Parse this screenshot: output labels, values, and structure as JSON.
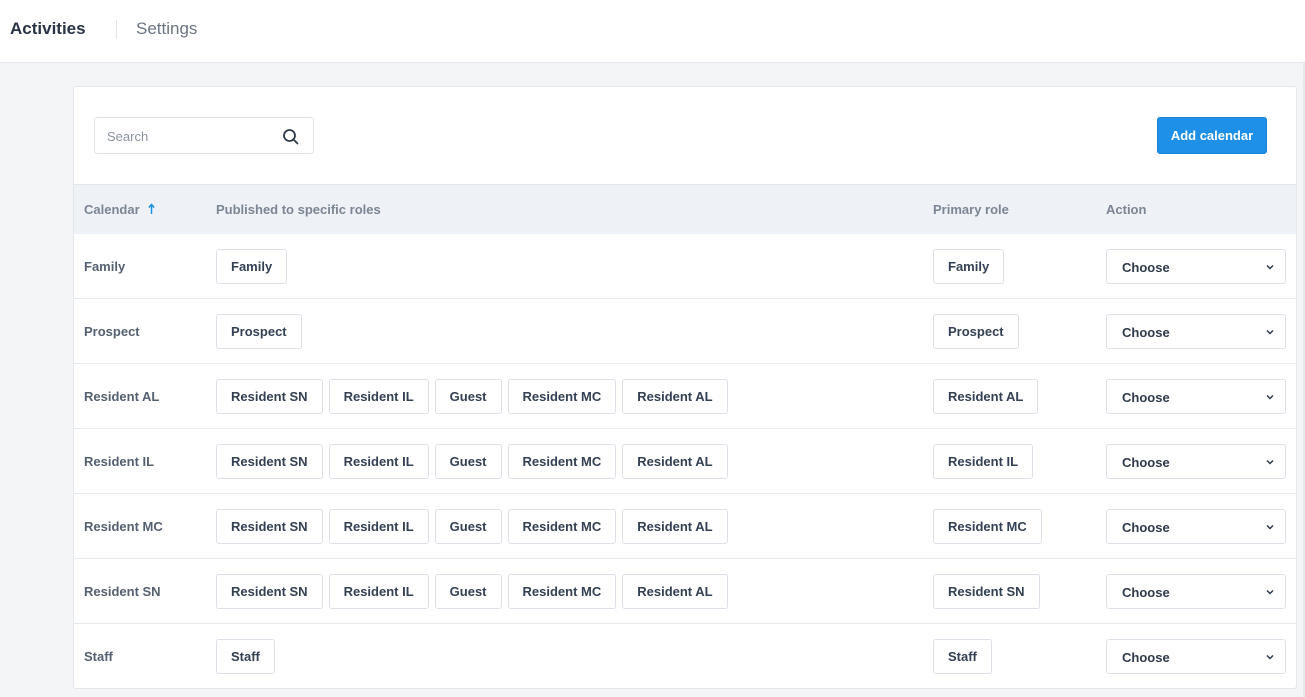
{
  "nav": {
    "active_tab": "Activities",
    "inactive_tab": "Settings"
  },
  "toolbar": {
    "search_placeholder": "Search",
    "search_icon": "search-icon",
    "add_button_label": "Add calendar"
  },
  "table": {
    "columns": {
      "calendar": "Calendar",
      "roles": "Published to specific roles",
      "primary": "Primary role",
      "action": "Action"
    },
    "sort_icon": "arrow-up-icon",
    "rows": [
      {
        "name": "Family",
        "roles": [
          "Family"
        ],
        "primary": "Family",
        "action": "Choose"
      },
      {
        "name": "Prospect",
        "roles": [
          "Prospect"
        ],
        "primary": "Prospect",
        "action": "Choose"
      },
      {
        "name": "Resident AL",
        "roles": [
          "Resident SN",
          "Resident IL",
          "Guest",
          "Resident MC",
          "Resident AL"
        ],
        "primary": "Resident AL",
        "action": "Choose"
      },
      {
        "name": "Resident IL",
        "roles": [
          "Resident SN",
          "Resident IL",
          "Guest",
          "Resident MC",
          "Resident AL"
        ],
        "primary": "Resident IL",
        "action": "Choose"
      },
      {
        "name": "Resident MC",
        "roles": [
          "Resident SN",
          "Resident IL",
          "Guest",
          "Resident MC",
          "Resident AL"
        ],
        "primary": "Resident MC",
        "action": "Choose"
      },
      {
        "name": "Resident SN",
        "roles": [
          "Resident SN",
          "Resident IL",
          "Guest",
          "Resident MC",
          "Resident AL"
        ],
        "primary": "Resident SN",
        "action": "Choose"
      },
      {
        "name": "Staff",
        "roles": [
          "Staff"
        ],
        "primary": "Staff",
        "action": "Choose"
      }
    ]
  },
  "colors": {
    "accent": "#1e90e8",
    "sort_arrow": "#1e90e8",
    "header_bg": "#eef1f6"
  }
}
